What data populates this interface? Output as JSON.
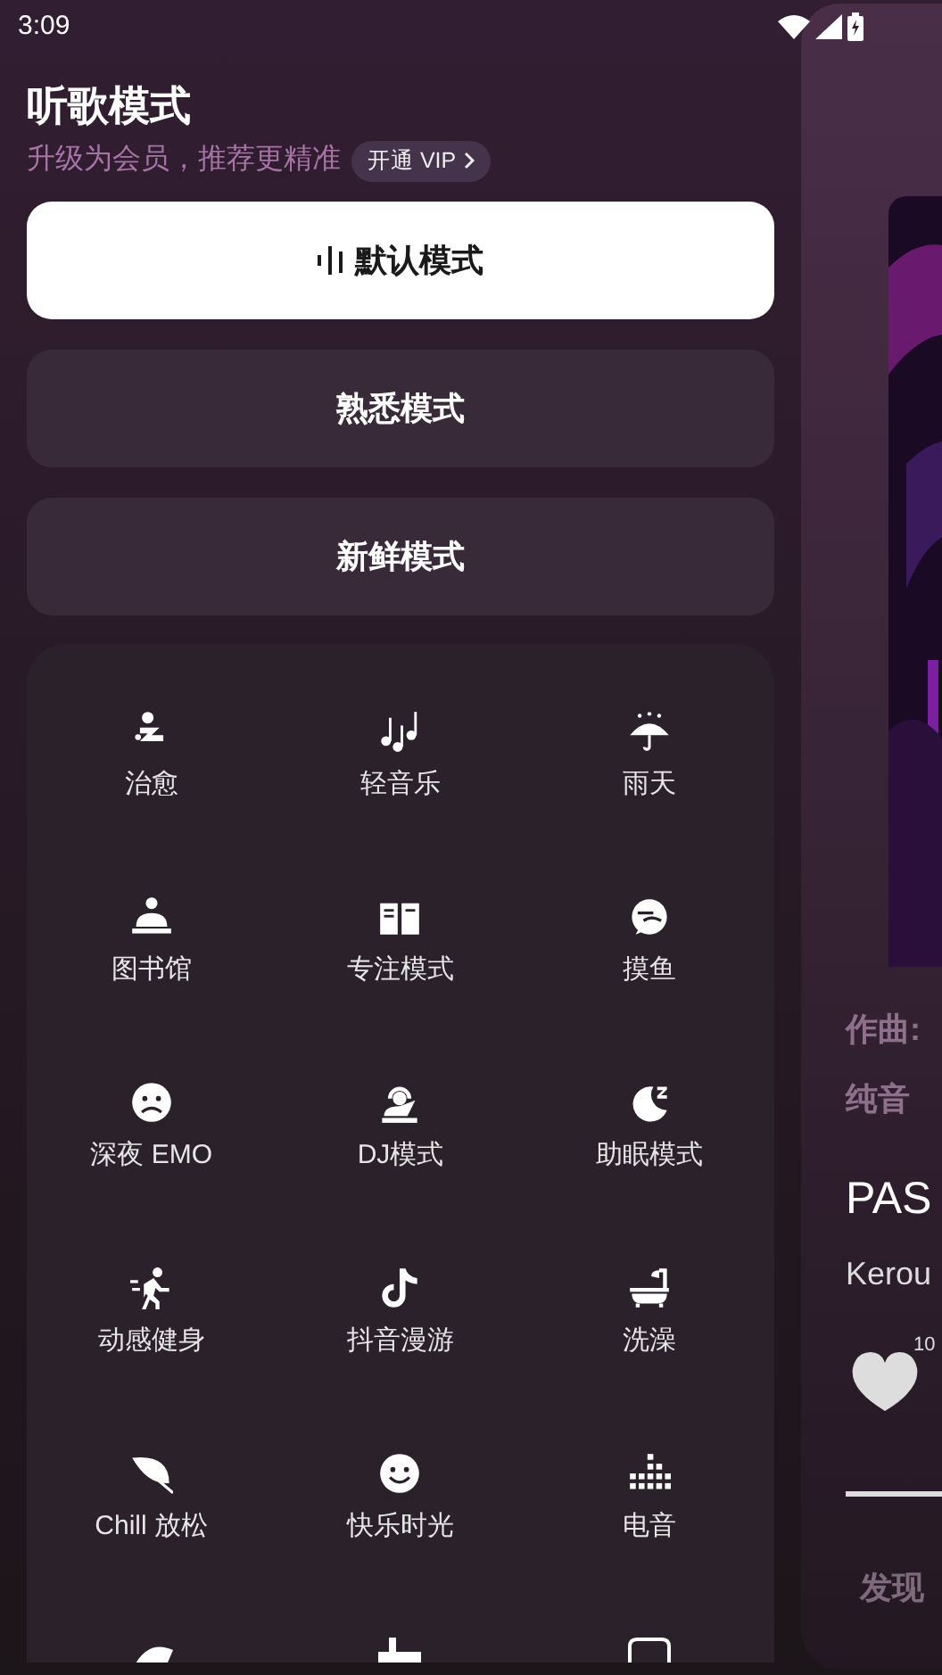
{
  "status_bar": {
    "time": "3:09"
  },
  "header": {
    "title": "听歌模式",
    "subtitle": "升级为会员，推荐更精准",
    "vip_link": "开通 VIP"
  },
  "modes": [
    {
      "label": "默认模式",
      "selected": true
    },
    {
      "label": "熟悉模式",
      "selected": false
    },
    {
      "label": "新鲜模式",
      "selected": false
    }
  ],
  "scenes": [
    {
      "label": "治愈"
    },
    {
      "label": "轻音乐"
    },
    {
      "label": "雨天"
    },
    {
      "label": "图书馆"
    },
    {
      "label": "专注模式"
    },
    {
      "label": "摸鱼"
    },
    {
      "label": "深夜 EMO"
    },
    {
      "label": "DJ模式"
    },
    {
      "label": "助眠模式"
    },
    {
      "label": "动感健身"
    },
    {
      "label": "抖音漫游"
    },
    {
      "label": "洗澡"
    },
    {
      "label": "Chill 放松"
    },
    {
      "label": "快乐时光"
    },
    {
      "label": "电音"
    }
  ],
  "player_card": {
    "kind": "picture",
    "credit": "作曲:",
    "genre": "纯音",
    "title": "PAS",
    "artist": "Kerou",
    "like_count": "10",
    "nav_tab": "发现"
  }
}
